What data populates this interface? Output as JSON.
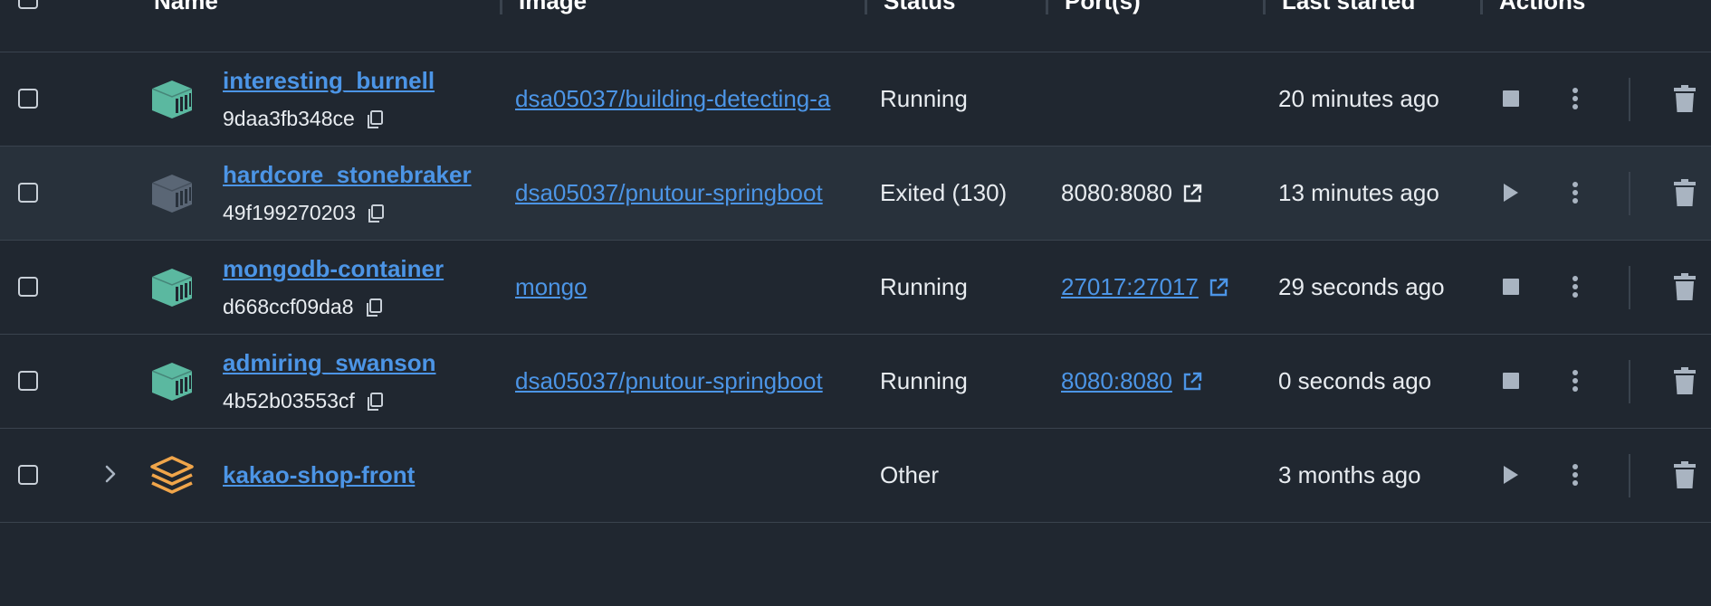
{
  "columns": {
    "name": "Name",
    "image": "Image",
    "status": "Status",
    "ports": "Port(s)",
    "last_started": "Last started",
    "actions": "Actions"
  },
  "colors": {
    "running_icon": "#5bb8a0",
    "exited_icon": "#5a6675",
    "stack_icon": "#f0a54a",
    "link": "#4c95e6"
  },
  "rows": [
    {
      "name": "interesting_burnell",
      "id": "9daa3fb348ce",
      "image": "dsa05037/building-detecting-a",
      "status": "Running",
      "ports": "",
      "last_started": "20 minutes ago",
      "primary_action": "stop-icon",
      "container_icon": "container-icon"
    },
    {
      "name": "hardcore_stonebraker",
      "id": "49f199270203",
      "image": "dsa05037/pnutour-springboot",
      "status": "Exited (130)",
      "ports": "8080:8080",
      "last_started": "13 minutes ago",
      "primary_action": "play-icon",
      "container_icon": "container-icon"
    },
    {
      "name": "mongodb-container",
      "id": "d668ccf09da8",
      "image": "mongo",
      "status": "Running",
      "ports": "27017:27017",
      "last_started": "29 seconds ago",
      "primary_action": "stop-icon",
      "container_icon": "container-icon"
    },
    {
      "name": "admiring_swanson",
      "id": "4b52b03553cf",
      "image": "dsa05037/pnutour-springboot",
      "status": "Running",
      "ports": "8080:8080",
      "last_started": "0 seconds ago",
      "primary_action": "stop-icon",
      "container_icon": "container-icon"
    },
    {
      "name": "kakao-shop-front",
      "status": "Other",
      "last_started": "3 months ago",
      "primary_action": "play-icon",
      "container_icon": "stack-icon",
      "expand_icon": "chevron-right-icon"
    }
  ]
}
